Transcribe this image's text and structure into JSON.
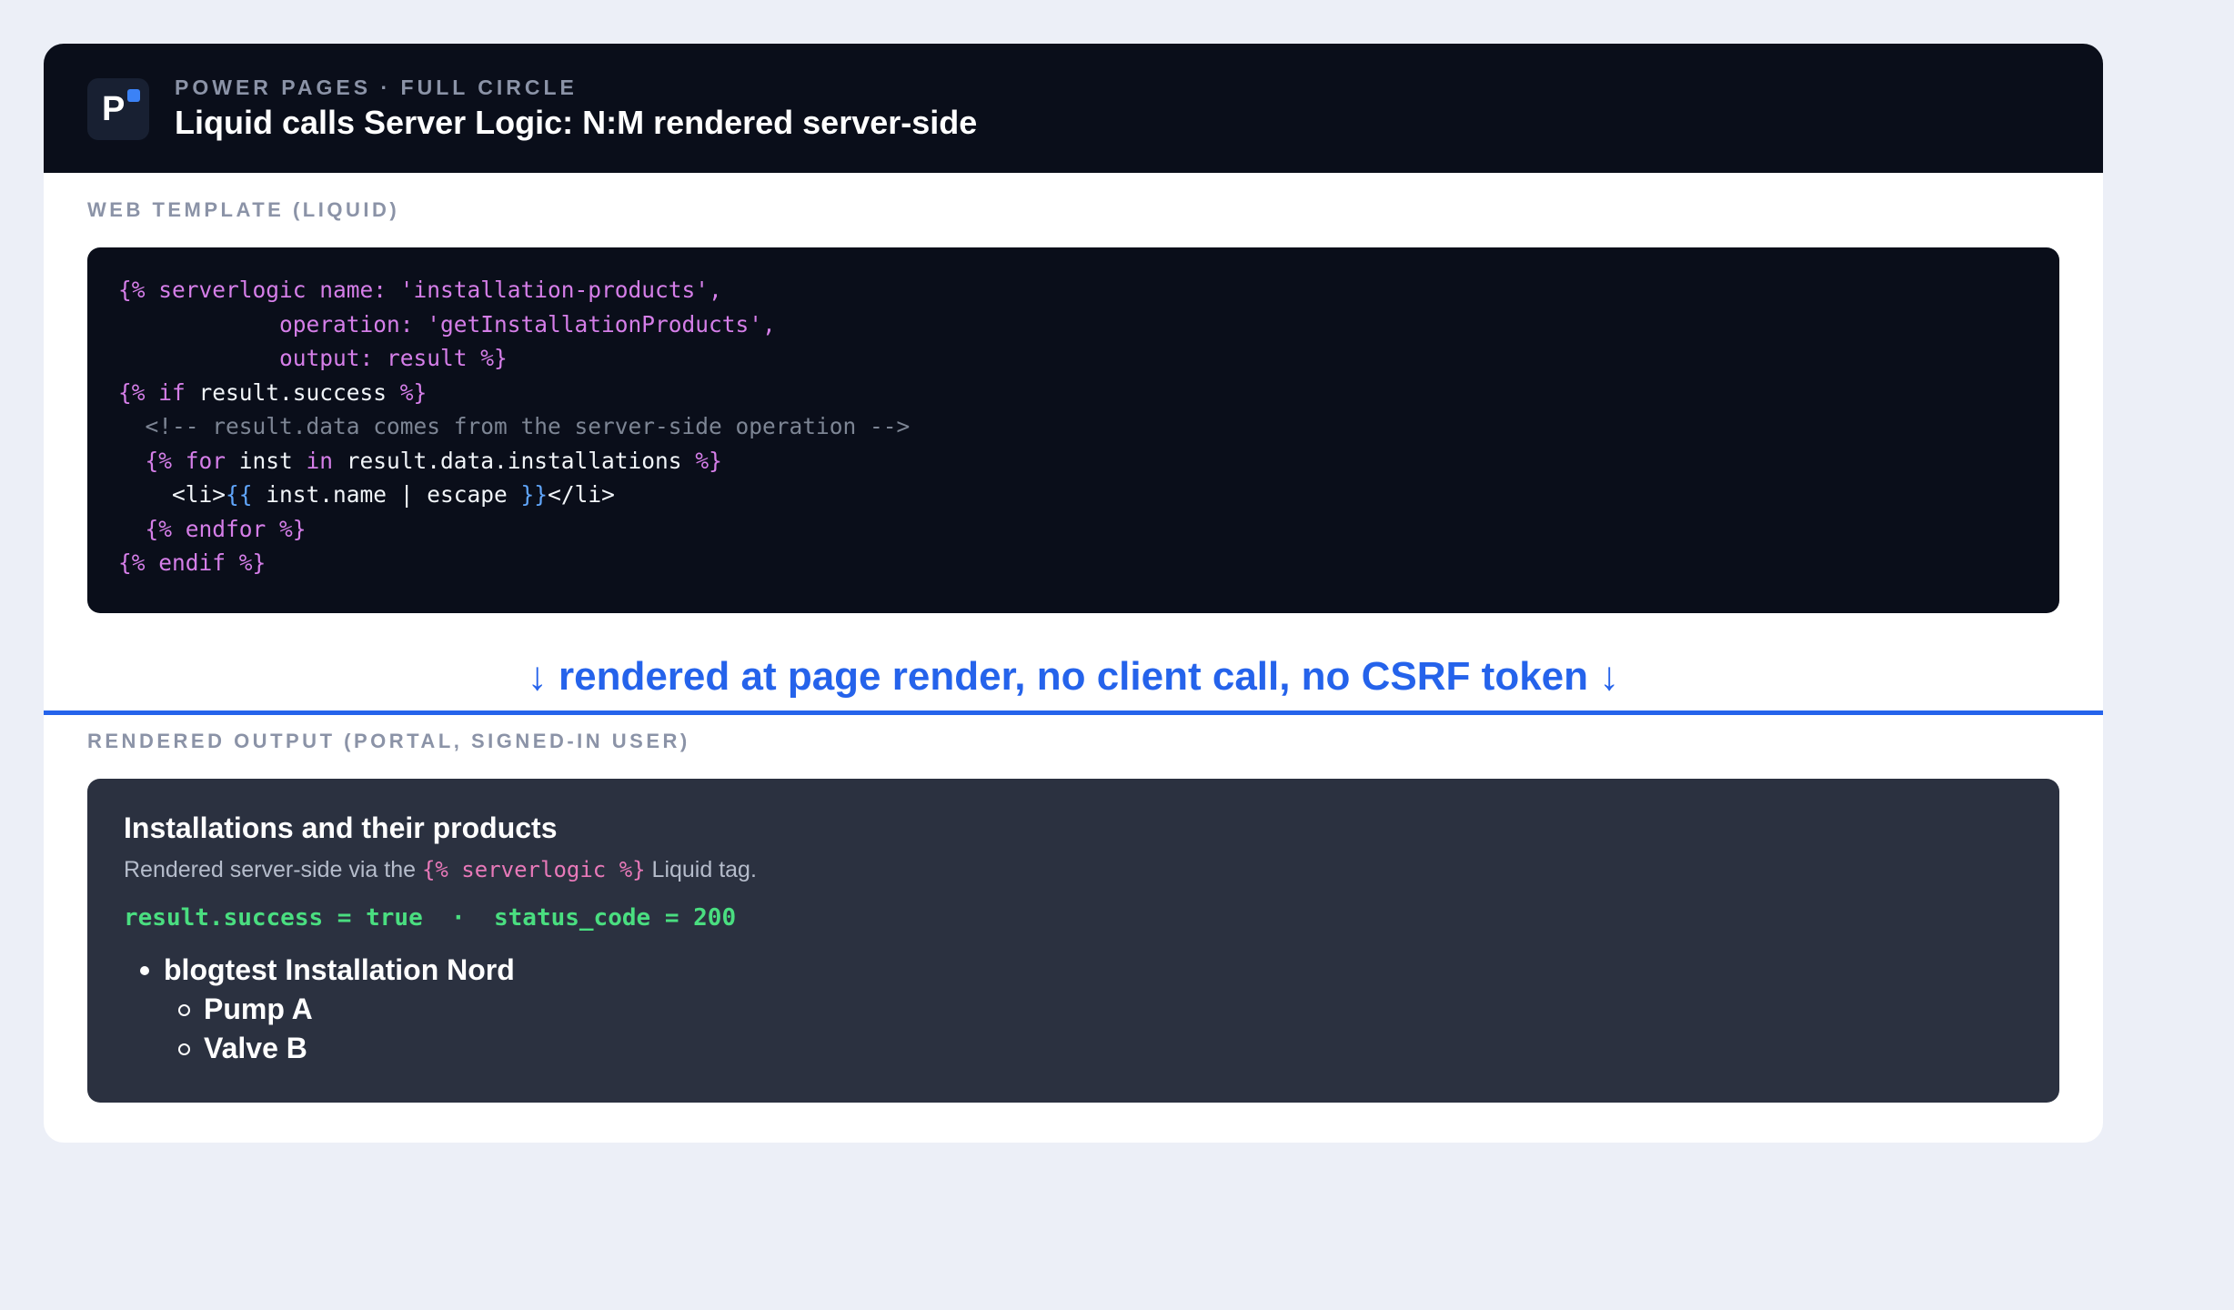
{
  "header": {
    "logo_letter": "P",
    "eyebrow": "POWER PAGES · FULL CIRCLE",
    "title": "Liquid calls Server Logic: N:M rendered server-side"
  },
  "template_section": {
    "label": "WEB TEMPLATE (LIQUID)",
    "code": {
      "l1_open": "{% serverlogic name: ",
      "l1_str": "'installation-products',",
      "l2_key": "            operation: ",
      "l2_str": "'getInstallationProducts',",
      "l3_text": "            output: result %}",
      "l4_kw": "{% if ",
      "l4_var": "result.success",
      "l4_close": " %}",
      "l5_comment": "  <!-- result.data comes from the server-side operation -->",
      "l6_open": "  {% for ",
      "l6_var1": "inst",
      "l6_in": " in ",
      "l6_var2": "result.data.installations",
      "l6_close": " %}",
      "l7_indent": "    <li>",
      "l7_open": "{{",
      "l7_expr": " inst.name | escape ",
      "l7_close": "}}",
      "l7_end": "</li>",
      "l8": "  {% endfor %}",
      "l9": "{% endif %}"
    }
  },
  "flow_note": "↓ rendered at page render, no client call, no CSRF token ↓",
  "output_section": {
    "label": "RENDERED OUTPUT (PORTAL, SIGNED-IN USER)",
    "title": "Installations and their products",
    "subtitle_pre": "Rendered server-side via the ",
    "subtitle_tag": "{% serverlogic %}",
    "subtitle_post": " Liquid tag.",
    "status_line": "result.success = true  ·  status_code = 200",
    "installation": "blogtest Installation Nord",
    "products": [
      "Pump A",
      "Valve B"
    ]
  },
  "colors": {
    "accent": "#2563eb",
    "liquid_tag": "#d57ee8",
    "output_tag": "#60a5fa",
    "success": "#4ade80",
    "header_bg": "#0a0e1a"
  }
}
